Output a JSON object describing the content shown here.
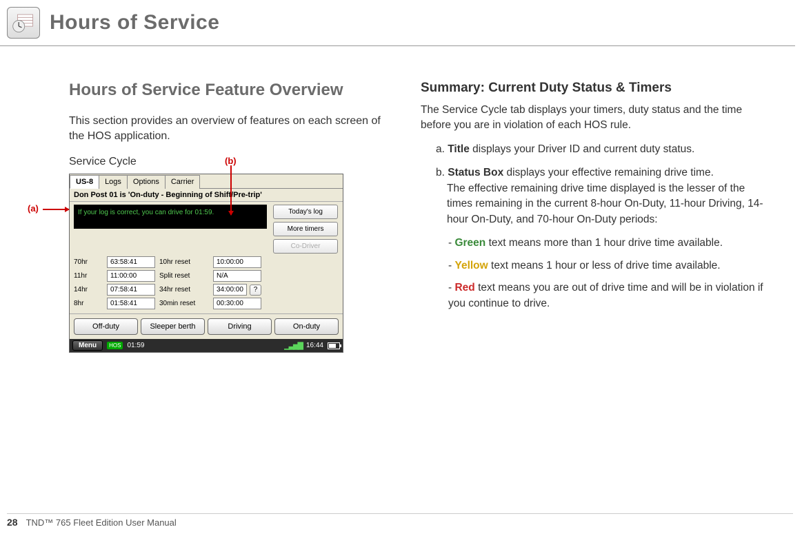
{
  "chapter": {
    "title": "Hours of Service"
  },
  "section": {
    "title": "Hours of Service Feature Overview"
  },
  "intro": "This section provides an overview of features on each screen of the HOS application.",
  "figure": {
    "caption": "Service Cycle",
    "callout_a": "(a)",
    "callout_b": "(b)",
    "tabs": [
      "US-8",
      "Logs",
      "Options",
      "Carrier"
    ],
    "title_bar": "Don Post 01 is 'On-duty - Beginning of Shift/Pre-trip'",
    "status_text": "If your log is correct, you can drive for 01:59.",
    "side_buttons": {
      "today": "Today's log",
      "more": "More timers",
      "codriver": "Co-Driver"
    },
    "timers": [
      {
        "lbl": "70hr",
        "val": "63:58:41",
        "rlbl": "10hr reset",
        "rval": "10:00:00"
      },
      {
        "lbl": "11hr",
        "val": "11:00:00",
        "rlbl": "Split reset",
        "rval": "N/A"
      },
      {
        "lbl": "14hr",
        "val": "07:58:41",
        "rlbl": "34hr reset",
        "rval": "34:00:00"
      },
      {
        "lbl": "8hr",
        "val": "01:58:41",
        "rlbl": "30min reset",
        "rval": "00:30:00"
      }
    ],
    "duty_buttons": [
      "Off-duty",
      "Sleeper berth",
      "Driving",
      "On-duty"
    ],
    "menu": {
      "label": "Menu",
      "hos_time": "01:59",
      "clock": "16:44"
    }
  },
  "summary": {
    "title": "Summary: Current Duty Status & Timers",
    "lead": "The Service Cycle tab displays your timers, duty status and the time before you are in violation of each HOS rule.",
    "a_prefix": "a. ",
    "a_bold": "Title",
    "a_rest": " displays your Driver ID and current duty status.",
    "b_prefix": "b. ",
    "b_bold": "Status Box",
    "b_rest1": " displays your effective remaining drive time.",
    "b_rest2": "The effective remaining drive time displayed is the lesser of the times remaining in the current 8-hour On-Duty, 11-hour Driving, 14-hour On-Duty, and 70-hour On-Duty periods:",
    "bullets": {
      "dash": "-    ",
      "green_word": "Green",
      "green_rest": " text means more than 1 hour drive time available.",
      "yellow_word": "Yellow",
      "yellow_rest": " text means 1 hour or less of drive time available.",
      "red_word": "Red",
      "red_rest": " text means you are out of drive time and will be in violation if you continue to drive."
    }
  },
  "footer": {
    "page": "28",
    "book": "TND™ 765 Fleet Edition User Manual"
  }
}
